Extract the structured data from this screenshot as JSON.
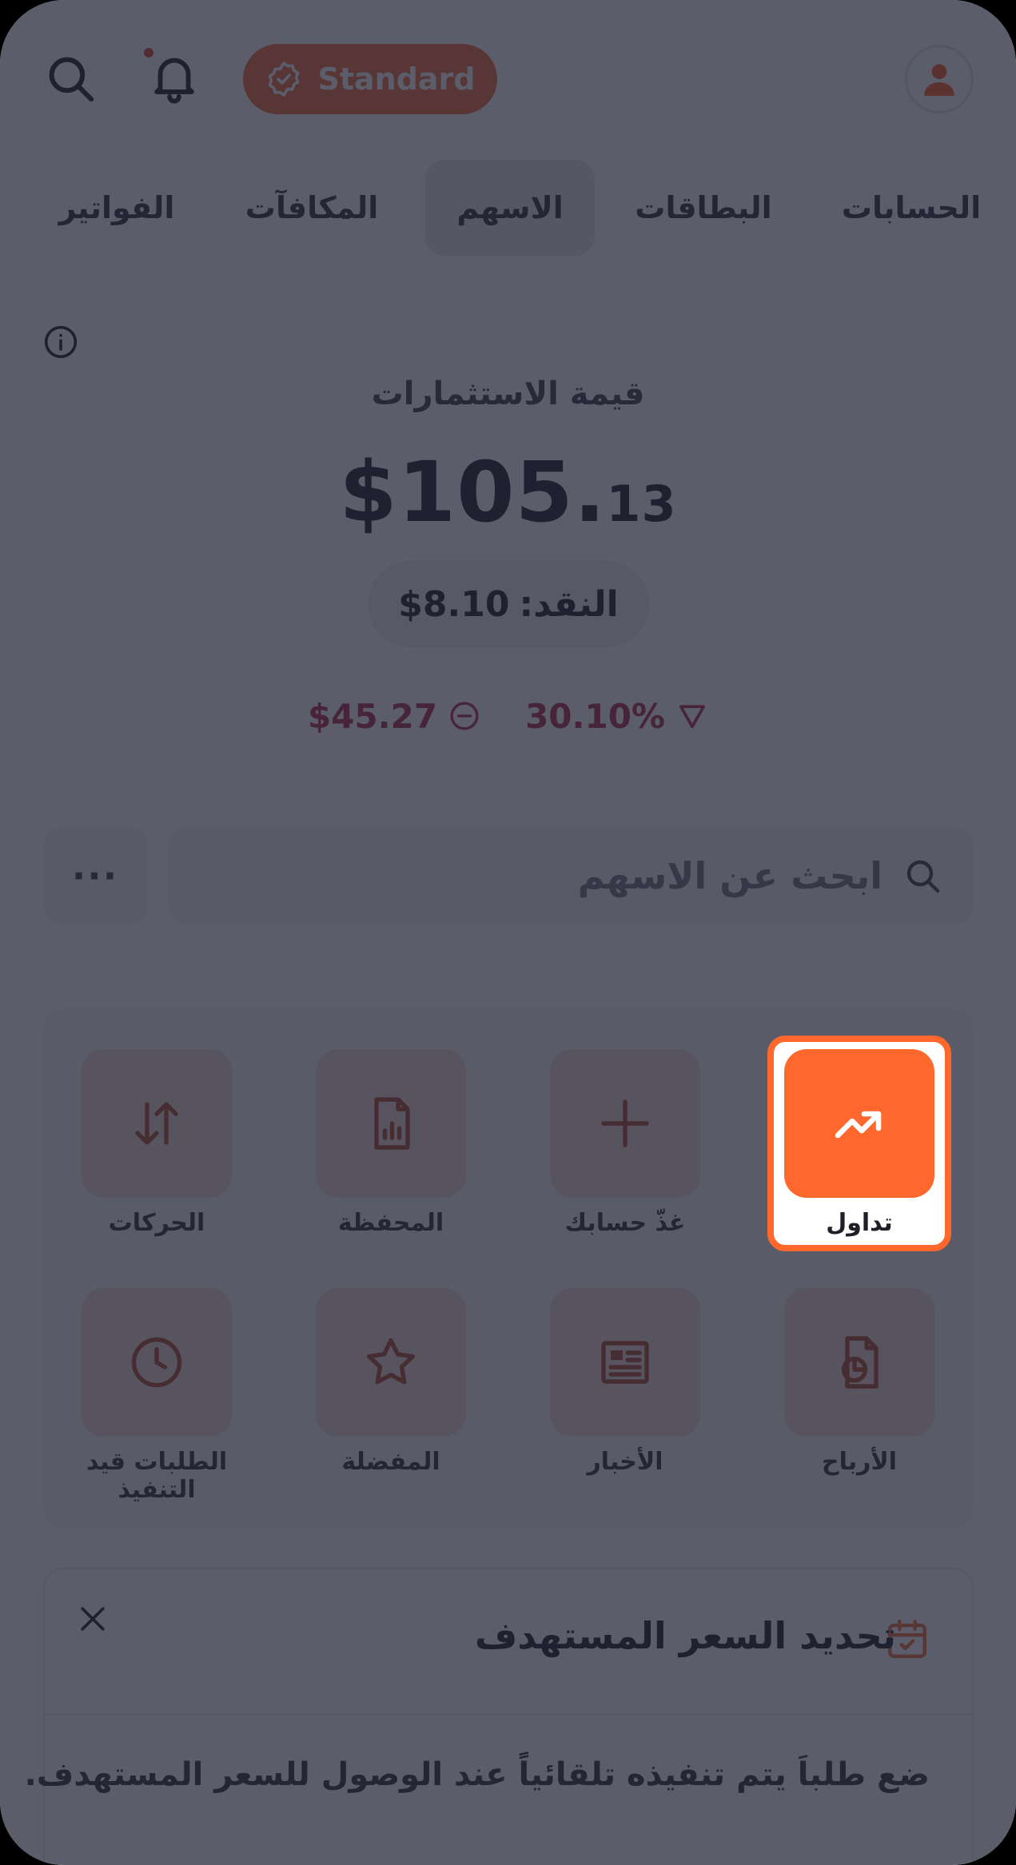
{
  "header": {
    "plan_label": "Standard",
    "search_icon": "search-icon",
    "bell_icon": "bell-icon",
    "avatar_icon": "user-icon"
  },
  "tabs": [
    {
      "label": "الحسابات"
    },
    {
      "label": "البطاقات"
    },
    {
      "label": "الاسهم",
      "active": true
    },
    {
      "label": "المكافآت"
    },
    {
      "label": "الفواتير"
    }
  ],
  "summary": {
    "title": "قيمة الاستثمارات",
    "value_main": "$105.",
    "value_cents": "13",
    "cash_label": "النقد:",
    "cash_value": "$8.10",
    "change_amount": "$45.27",
    "change_percent": "30.10%"
  },
  "search": {
    "placeholder": "ابحث عن الاسهم",
    "more_label": "···"
  },
  "actions": [
    {
      "label": "تداول",
      "icon": "trending-up-icon"
    },
    {
      "label": "غذّ حسابك",
      "icon": "plus-icon"
    },
    {
      "label": "المحفظة",
      "icon": "report-icon"
    },
    {
      "label": "الحركات",
      "icon": "transfer-arrows-icon"
    },
    {
      "label": "الأرباح",
      "icon": "dividends-icon"
    },
    {
      "label": "الأخبار",
      "icon": "news-icon"
    },
    {
      "label": "المفضلة",
      "icon": "star-icon"
    },
    {
      "label": "الطلبات قيد التنفيذ",
      "icon": "clock-icon"
    }
  ],
  "card": {
    "title": "تحديد السعر المستهدف",
    "body": "ضع طلباَ يتم تنفيذه تلقائياً عند الوصول للسعر المستهدف."
  },
  "colors": {
    "accent": "#ff672c",
    "tile_bg": "#f3dfd8",
    "negative": "#b3334f",
    "overlay": "#1c1e30"
  }
}
